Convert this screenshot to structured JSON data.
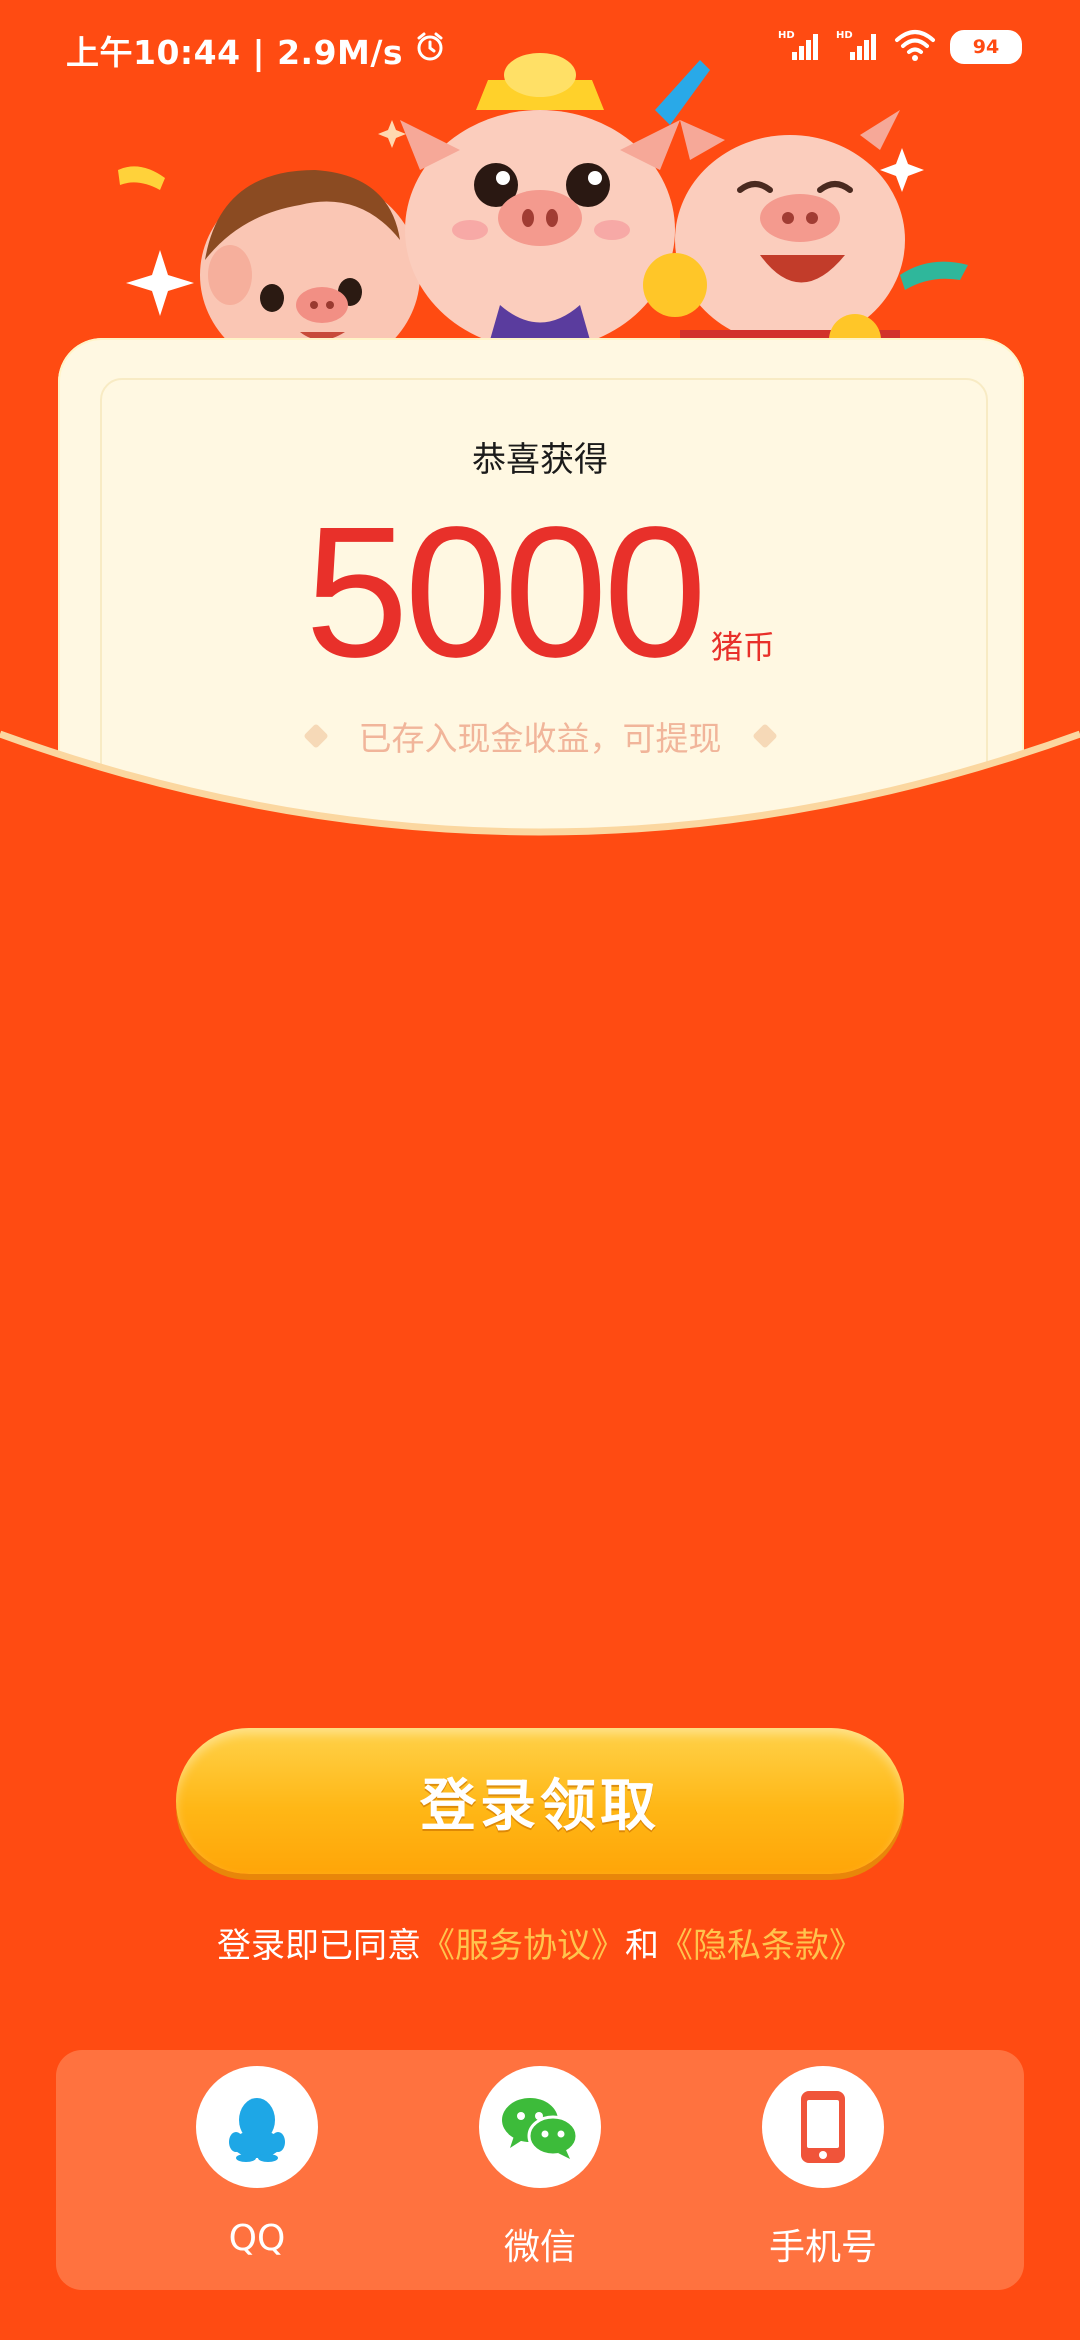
{
  "status_bar": {
    "time_speed": "上午10:44 | 2.9M/s",
    "battery": "94",
    "alarm_icon": "alarm-clock-icon",
    "signal_icons": [
      "hd-signal-icon",
      "hd-signal-icon",
      "wifi-icon"
    ]
  },
  "card": {
    "title": "恭喜获得",
    "amount": "5000",
    "unit": "猪币",
    "subtext": "已存入现金收益，可提现"
  },
  "login": {
    "button_label": "登录领取",
    "agreement_prefix": "登录即已同意",
    "service_link": "《服务协议》",
    "and": "和",
    "privacy_link": "《隐私条款》"
  },
  "options": [
    {
      "label": "QQ",
      "icon": "qq-icon"
    },
    {
      "label": "微信",
      "icon": "wechat-icon"
    },
    {
      "label": "手机号",
      "icon": "phone-icon"
    }
  ],
  "colors": {
    "background": "#FF4B12",
    "amount": "#E8302A",
    "button": "#FFB716",
    "link": "#FFC44D"
  }
}
